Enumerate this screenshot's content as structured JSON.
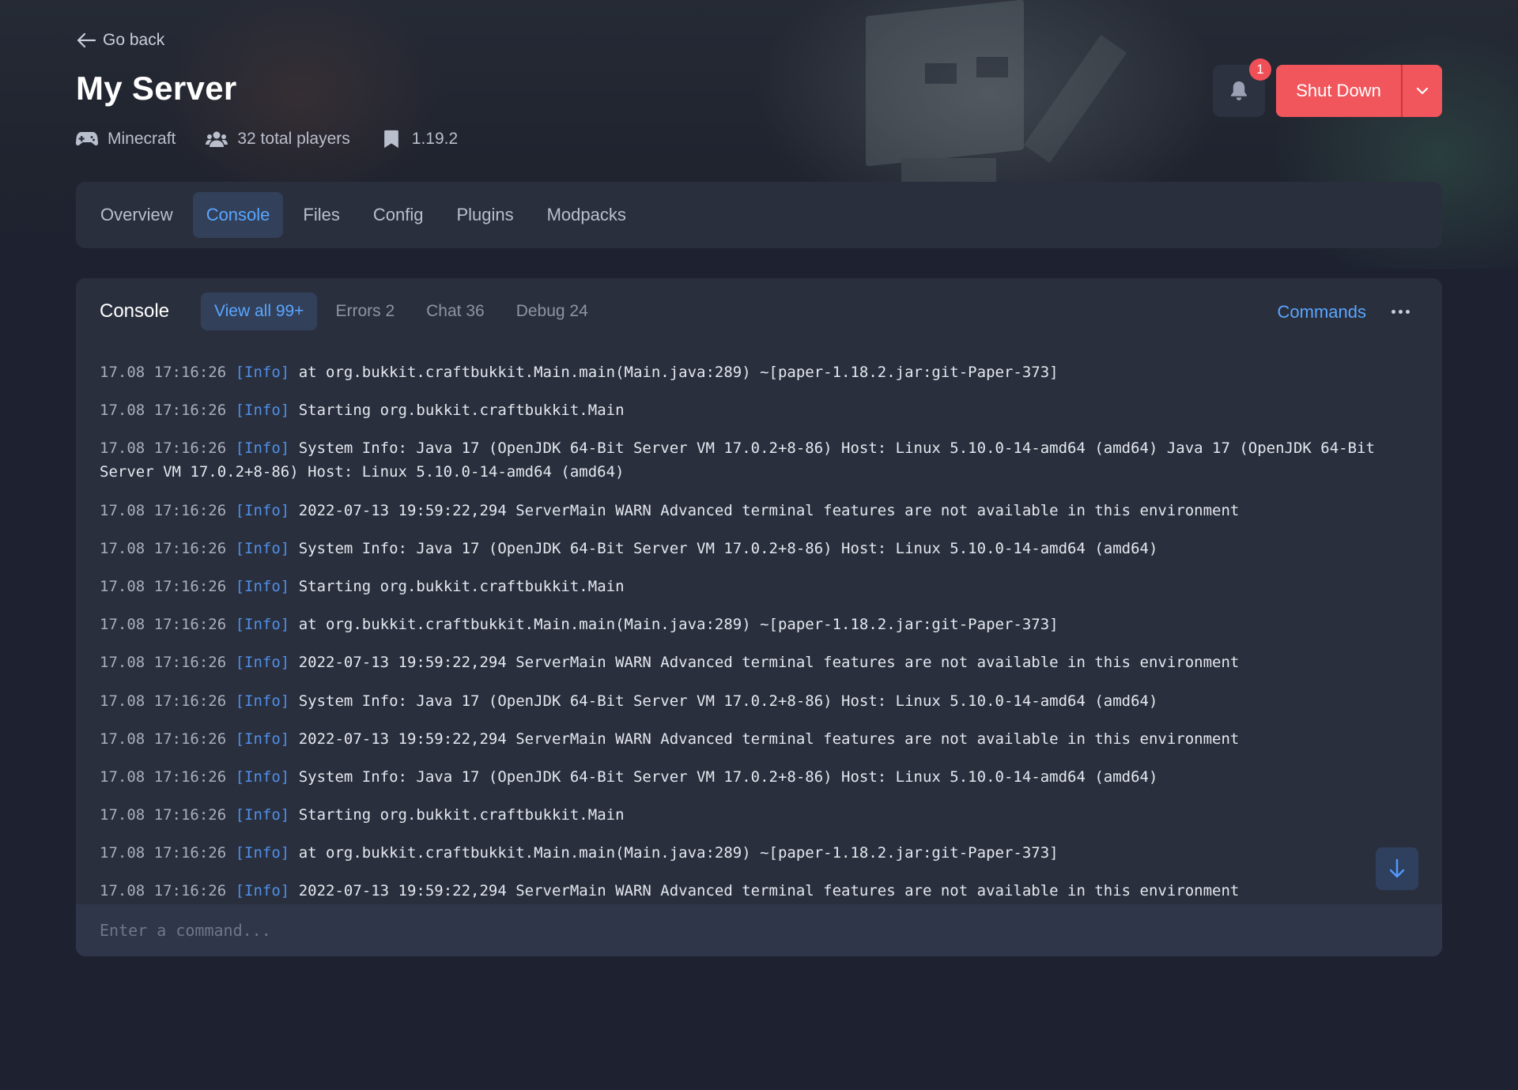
{
  "nav": {
    "back_label": "Go back"
  },
  "server": {
    "name": "My Server",
    "game": "Minecraft",
    "players": "32 total players",
    "version": "1.19.2"
  },
  "actions": {
    "notification_count": "1",
    "shutdown_label": "Shut Down"
  },
  "tabs": [
    {
      "label": "Overview",
      "active": false
    },
    {
      "label": "Console",
      "active": true
    },
    {
      "label": "Files",
      "active": false
    },
    {
      "label": "Config",
      "active": false
    },
    {
      "label": "Plugins",
      "active": false
    },
    {
      "label": "Modpacks",
      "active": false
    }
  ],
  "console": {
    "title": "Console",
    "filters": [
      {
        "label": "View all 99+",
        "active": true
      },
      {
        "label": "Errors 2",
        "active": false
      },
      {
        "label": "Chat 36",
        "active": false
      },
      {
        "label": "Debug 24",
        "active": false
      }
    ],
    "commands_label": "Commands",
    "input_placeholder": "Enter a command...",
    "lines": [
      {
        "ts": "17.08 17:16:26",
        "level": "[Info]",
        "msg": "at org.bukkit.craftbukkit.Main.main(Main.java:289) ~[paper-1.18.2.jar:git-Paper-373]"
      },
      {
        "ts": "17.08 17:16:26",
        "level": "[Info]",
        "msg": "Starting org.bukkit.craftbukkit.Main"
      },
      {
        "ts": "17.08 17:16:26",
        "level": "[Info]",
        "msg": "System Info: Java 17 (OpenJDK 64-Bit Server VM 17.0.2+8-86) Host: Linux 5.10.0-14-amd64 (amd64) Java 17 (OpenJDK 64-Bit Server VM 17.0.2+8-86) Host: Linux 5.10.0-14-amd64 (amd64)"
      },
      {
        "ts": "17.08 17:16:26",
        "level": "[Info]",
        "msg": "2022-07-13 19:59:22,294 ServerMain WARN Advanced terminal features are not available in this environment"
      },
      {
        "ts": "17.08 17:16:26",
        "level": "[Info]",
        "msg": "System Info: Java 17 (OpenJDK 64-Bit Server VM 17.0.2+8-86) Host: Linux 5.10.0-14-amd64 (amd64)"
      },
      {
        "ts": "17.08 17:16:26",
        "level": "[Info]",
        "msg": "Starting org.bukkit.craftbukkit.Main"
      },
      {
        "ts": "17.08 17:16:26",
        "level": "[Info]",
        "msg": "at org.bukkit.craftbukkit.Main.main(Main.java:289) ~[paper-1.18.2.jar:git-Paper-373]"
      },
      {
        "ts": "17.08 17:16:26",
        "level": "[Info]",
        "msg": "2022-07-13 19:59:22,294 ServerMain WARN Advanced terminal features are not available in this environment"
      },
      {
        "ts": "17.08 17:16:26",
        "level": "[Info]",
        "msg": "System Info: Java 17 (OpenJDK 64-Bit Server VM 17.0.2+8-86) Host: Linux 5.10.0-14-amd64 (amd64)"
      },
      {
        "ts": "17.08 17:16:26",
        "level": "[Info]",
        "msg": "2022-07-13 19:59:22,294 ServerMain WARN Advanced terminal features are not available in this environment"
      },
      {
        "ts": "17.08 17:16:26",
        "level": "[Info]",
        "msg": "System Info: Java 17 (OpenJDK 64-Bit Server VM 17.0.2+8-86) Host: Linux 5.10.0-14-amd64 (amd64)"
      },
      {
        "ts": "17.08 17:16:26",
        "level": "[Info]",
        "msg": "Starting org.bukkit.craftbukkit.Main"
      },
      {
        "ts": "17.08 17:16:26",
        "level": "[Info]",
        "msg": "at org.bukkit.craftbukkit.Main.main(Main.java:289) ~[paper-1.18.2.jar:git-Paper-373]"
      },
      {
        "ts": "17.08 17:16:26",
        "level": "[Info]",
        "msg": "2022-07-13 19:59:22,294 ServerMain WARN Advanced terminal features are not available in this environment"
      }
    ]
  },
  "icons": {
    "back": "arrow-left-icon",
    "game": "gamepad-icon",
    "players": "users-icon",
    "version": "bookmark-icon",
    "bell": "bell-icon",
    "dropdown": "chevron-down-icon",
    "more": "more-horizontal-icon",
    "scroll": "arrow-down-icon"
  },
  "colors": {
    "accent": "#5aa6ff",
    "danger": "#f0565c",
    "background": "#1e2230",
    "panel": "#2a2f3d",
    "info_level": "#4f8fe6"
  }
}
